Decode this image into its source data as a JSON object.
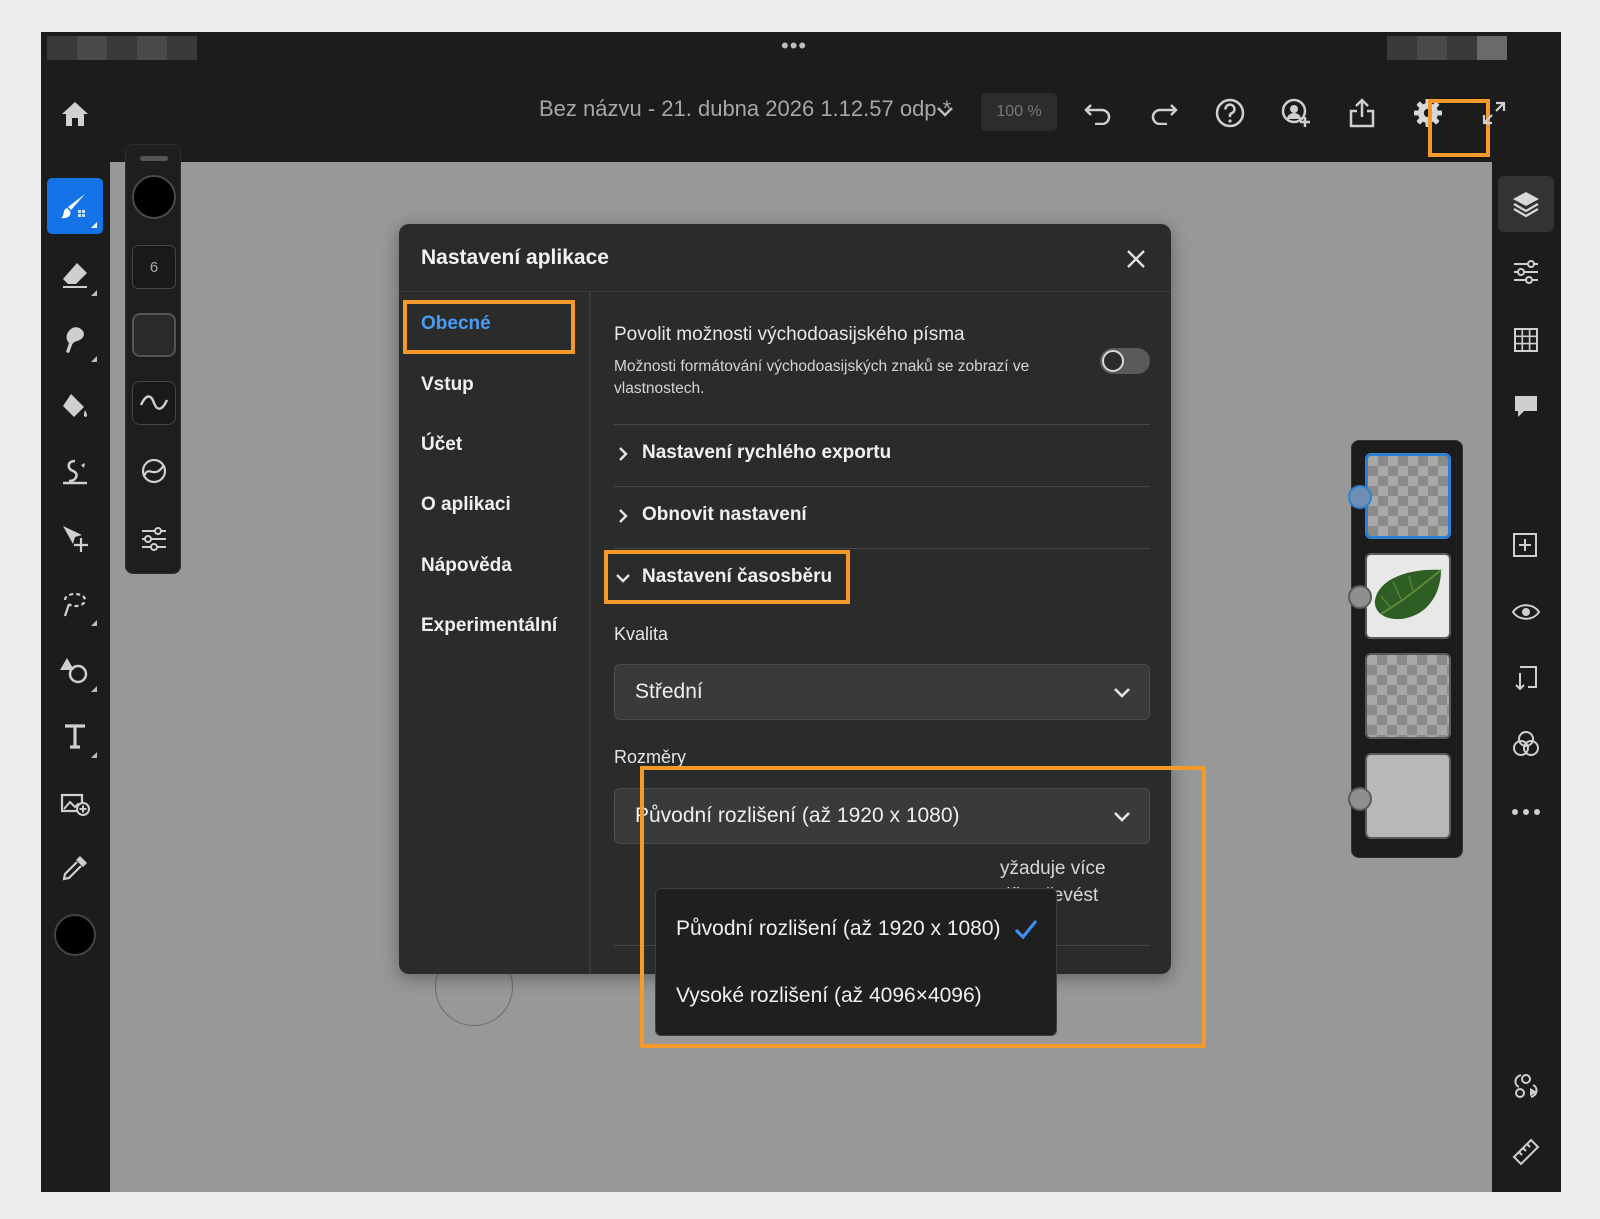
{
  "app": {
    "document_title": "Bez názvu - 21. dubna 2026 1.12.57 odp *",
    "zoom": "100 %"
  },
  "brush_panel": {
    "size_value": "6"
  },
  "dialog": {
    "title": "Nastavení aplikace",
    "nav": [
      {
        "label": "Obecné",
        "active": true
      },
      {
        "label": "Vstup"
      },
      {
        "label": "Účet"
      },
      {
        "label": "O aplikaci"
      },
      {
        "label": "Nápověda"
      },
      {
        "label": "Experimentální"
      }
    ],
    "content": {
      "east_asian": {
        "title": "Povolit možnosti východoasijského písma",
        "description": "Možnosti formátování východoasijských znaků se zobrazí ve vlastnostech.",
        "enabled": false
      },
      "sections": [
        {
          "label": "Nastavení rychlého exportu",
          "expanded": false
        },
        {
          "label": "Obnovit nastavení",
          "expanded": false
        },
        {
          "label": "Nastavení časosběru",
          "expanded": true
        }
      ],
      "quality": {
        "label": "Kvalita",
        "value": "Střední"
      },
      "dimensions": {
        "label": "Rozměry",
        "value": "Původní rozlišení (až 1920 x 1080)",
        "behind_text_1": "yžaduje více",
        "behind_text_2": "dílo převést",
        "options": [
          {
            "label": "Původní rozlišení (až 1920 x 1080)",
            "selected": true
          },
          {
            "label": "Vysoké rozlišení (až 4096×4096)",
            "selected": false
          }
        ]
      }
    }
  },
  "colors": {
    "accent_blue": "#1473e6",
    "highlight_orange": "#f39a2b",
    "active_nav": "#4a9df5"
  }
}
